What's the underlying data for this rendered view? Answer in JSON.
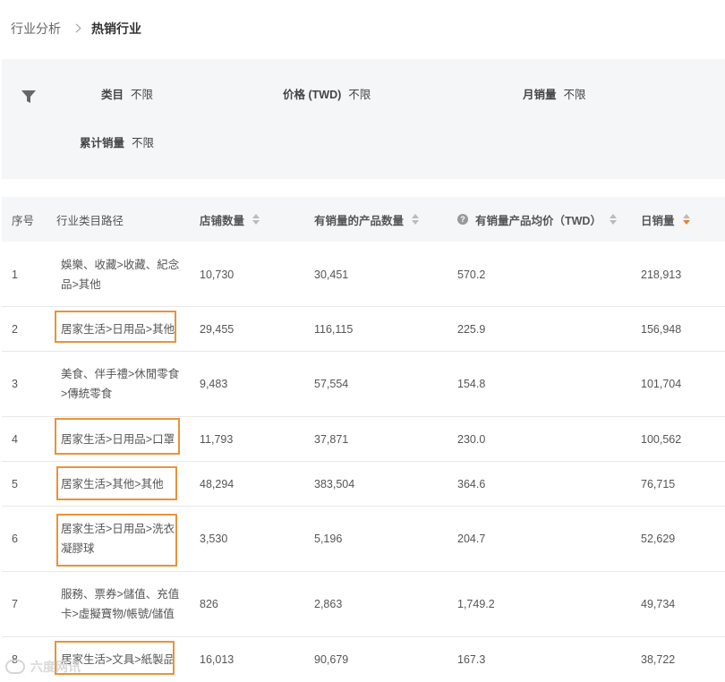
{
  "breadcrumb": {
    "parent": "行业分析",
    "current": "热销行业"
  },
  "filters": {
    "category": {
      "label": "类目",
      "value": "不限"
    },
    "price": {
      "label": "价格 (TWD)",
      "value": "不限"
    },
    "monthly": {
      "label": "月销量",
      "value": "不限"
    },
    "cumulative": {
      "label": "累计销量",
      "value": "不限"
    }
  },
  "columns": {
    "index": "序号",
    "path": "行业类目路径",
    "shops": "店铺数量",
    "products": "有销量的产品数量",
    "avg_price": "有销量产品均价（TWD）",
    "daily": "日销量"
  },
  "rows": [
    {
      "index": "1",
      "path_line1": "娛樂、收藏>收藏、紀念",
      "path_line2": "品>其他",
      "shops": "10,730",
      "products": "30,451",
      "avg_price": "570.2",
      "daily": "218,913"
    },
    {
      "index": "2",
      "path_line1": "居家生活>日用品>其他",
      "path_line2": "",
      "shops": "29,455",
      "products": "116,115",
      "avg_price": "225.9",
      "daily": "156,948"
    },
    {
      "index": "3",
      "path_line1": "美食、伴手禮>休閒零食",
      "path_line2": ">傳統零食",
      "shops": "9,483",
      "products": "57,554",
      "avg_price": "154.8",
      "daily": "101,704"
    },
    {
      "index": "4",
      "path_line1": "居家生活>日用品>口罩",
      "path_line2": "",
      "shops": "11,793",
      "products": "37,871",
      "avg_price": "230.0",
      "daily": "100,562"
    },
    {
      "index": "5",
      "path_line1": "居家生活>其他>其他",
      "path_line2": "",
      "shops": "48,294",
      "products": "383,504",
      "avg_price": "364.6",
      "daily": "76,715"
    },
    {
      "index": "6",
      "path_line1": "居家生活>日用品>洗衣",
      "path_line2": "凝膠球",
      "shops": "3,530",
      "products": "5,196",
      "avg_price": "204.7",
      "daily": "52,629"
    },
    {
      "index": "7",
      "path_line1": "服務、票券>儲值、充值",
      "path_line2": "卡>虛擬寶物/帳號/儲值",
      "shops": "826",
      "products": "2,863",
      "avg_price": "1,749.2",
      "daily": "49,734"
    },
    {
      "index": "8",
      "path_line1": "居家生活>文具>紙製品",
      "path_line2": "",
      "shops": "16,013",
      "products": "90,679",
      "avg_price": "167.3",
      "daily": "38,722"
    }
  ],
  "watermark": "六度网讯",
  "colors": {
    "highlight": "#e8943a",
    "sort_active": "#e8832e",
    "panel_bg": "#f5f6f8"
  },
  "icons": {
    "filter": "funnel-icon",
    "sort": "sort-arrows-icon",
    "help": "question-circle-icon",
    "separator": "chevron-right-icon"
  }
}
